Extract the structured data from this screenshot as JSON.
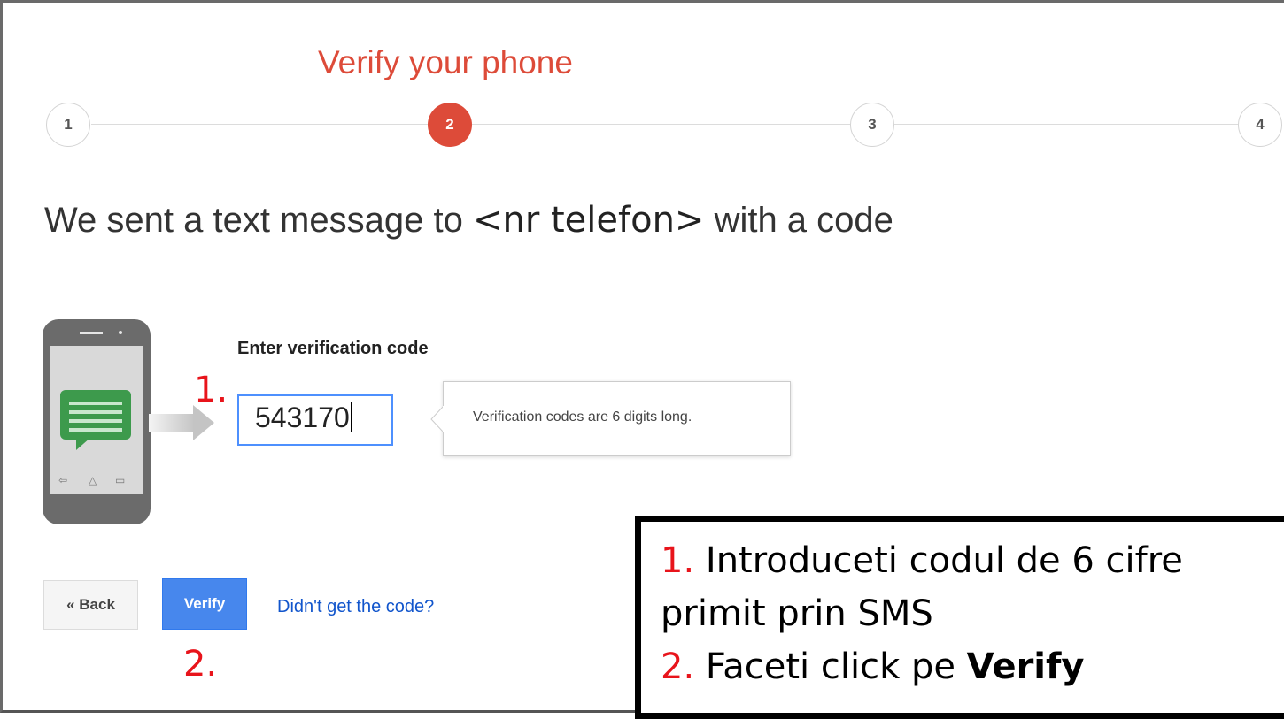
{
  "stepper": {
    "title": "Verify your phone",
    "steps": [
      "1",
      "2",
      "3",
      "4"
    ],
    "active_step": 2,
    "colors": {
      "active": "#dd4b39",
      "inactive_border": "#d4d4d4"
    }
  },
  "headline": {
    "before": "We sent a text message to",
    "phone": "<nr telefon>",
    "after": "with a code"
  },
  "form": {
    "label": "Enter verification code",
    "code_value": "543170",
    "tooltip": "Verification codes are 6 digits long."
  },
  "buttons": {
    "back": "« Back",
    "verify": "Verify",
    "resend_link": "Didn't get the code?"
  },
  "annotations": {
    "marker_1": "1.",
    "marker_2": "2.",
    "note_line1_num": "1.",
    "note_line1_text": "Introduceti codul de 6 cifre",
    "note_line2_text": "primit prin SMS",
    "note_line3_num": "2.",
    "note_line3_text": "Faceti click pe",
    "note_line3_bold": "Verify"
  },
  "icons": [
    "phone-illustration-icon",
    "sms-bubble-icon",
    "arrow-right-icon"
  ]
}
